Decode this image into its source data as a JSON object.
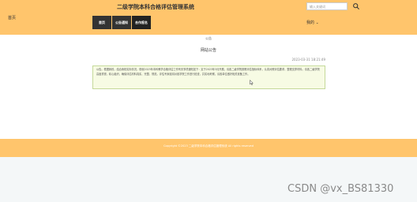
{
  "header": {
    "site_title": "二级学院本科合格评估管理系统",
    "search_placeholder": "输入关键词",
    "logo_text": "首页",
    "user_label": "我的",
    "user_caret": "⌄"
  },
  "nav": {
    "items": [
      {
        "label": "首页"
      },
      {
        "label": "公告通知"
      },
      {
        "label": "合作报名"
      }
    ]
  },
  "breadcrumb": "公告",
  "notice": {
    "title": "网站公告",
    "time": "2023-03-31 18:21:49",
    "content": "公告。根据我校，结合我校实际情况，现就2023年本科教学合格评估工作有关事项通知如下：定于2023年3月开展，请各二级学院按照评估指标体系，认真对照评估要求，整理支撑材料。请各二级学院高度重视，精心组织，确保评估材料真实、完整、规范。评估专家组将对各学院工作进行检查，并实地考察，请各单位做好相关准备工作。"
  },
  "footer": {
    "copyright": "Copyright ©2023 二级学院本科合格评估管理系统 All rights reserved"
  },
  "watermark": "CSDN @vx_BS81330",
  "colors": {
    "header_bg": "#ffc56c",
    "nav_bg": "#333333",
    "content_bg": "#f7fbe4",
    "content_border": "#c5d99a",
    "footer_bg": "#ffc56c",
    "bottom_bg": "#f4f7f8"
  }
}
